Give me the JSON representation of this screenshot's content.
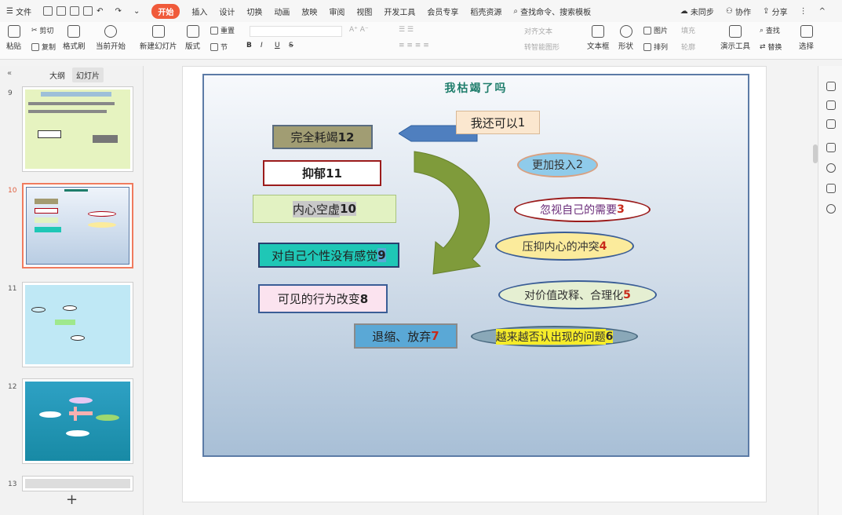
{
  "menubar": {
    "file": "文件",
    "tabs": [
      "开始",
      "插入",
      "设计",
      "切换",
      "动画",
      "放映",
      "审阅",
      "视图",
      "开发工具",
      "会员专享",
      "稻壳资源"
    ],
    "active_tab": "开始",
    "search_placeholder": "查找命令、搜索模板",
    "unsynced": "未同步",
    "collab": "协作",
    "share": "分享"
  },
  "toolbar": {
    "paste": "粘贴",
    "cut": "剪切",
    "copy": "复制",
    "format_painter": "格式刷",
    "play_from_current": "当前开始",
    "new_slide": "新建幻灯片",
    "layout": "版式",
    "section": "节",
    "reset": "重置",
    "align_text": "对齐文本",
    "smart_art": "转智能图形",
    "text_box": "文本框",
    "shape": "形状",
    "arrange": "排列",
    "picture": "图片",
    "fill": "填充",
    "outline": "轮廓",
    "present_tools": "演示工具",
    "find": "查找",
    "replace": "替换",
    "select": "选择"
  },
  "panel": {
    "tab_outline": "大纲",
    "tab_slides": "幻灯片",
    "slide_numbers": [
      "9",
      "10",
      "11",
      "12",
      "13"
    ],
    "add": "+"
  },
  "slide": {
    "title": "我枯竭了吗",
    "items": [
      {
        "text": "完全耗竭",
        "n": "12"
      },
      {
        "text": "抑郁",
        "n": "11"
      },
      {
        "text": "内心空虚",
        "n": "10"
      },
      {
        "text": "对自己个性没有感觉",
        "n": "9"
      },
      {
        "text": "可见的行为改变",
        "n": "8"
      },
      {
        "text": "退缩、放弃",
        "n": "7"
      },
      {
        "text": "越来越否认出现的问题",
        "n": "6"
      },
      {
        "text": "对价值改释、合理化",
        "n": "5"
      },
      {
        "text": "压抑内心的冲突",
        "n": "4"
      },
      {
        "text": "忽视自己的需要",
        "n": "3"
      },
      {
        "text": "更加投入",
        "n": "2"
      },
      {
        "text": "我还可以",
        "n": "1"
      }
    ]
  },
  "colors": {
    "accent": "#f05a3a",
    "slide_border": "#5c7ba6",
    "title": "#1e7d6b",
    "arrow": "#7f9b3b",
    "num_red": "#c8291a"
  }
}
